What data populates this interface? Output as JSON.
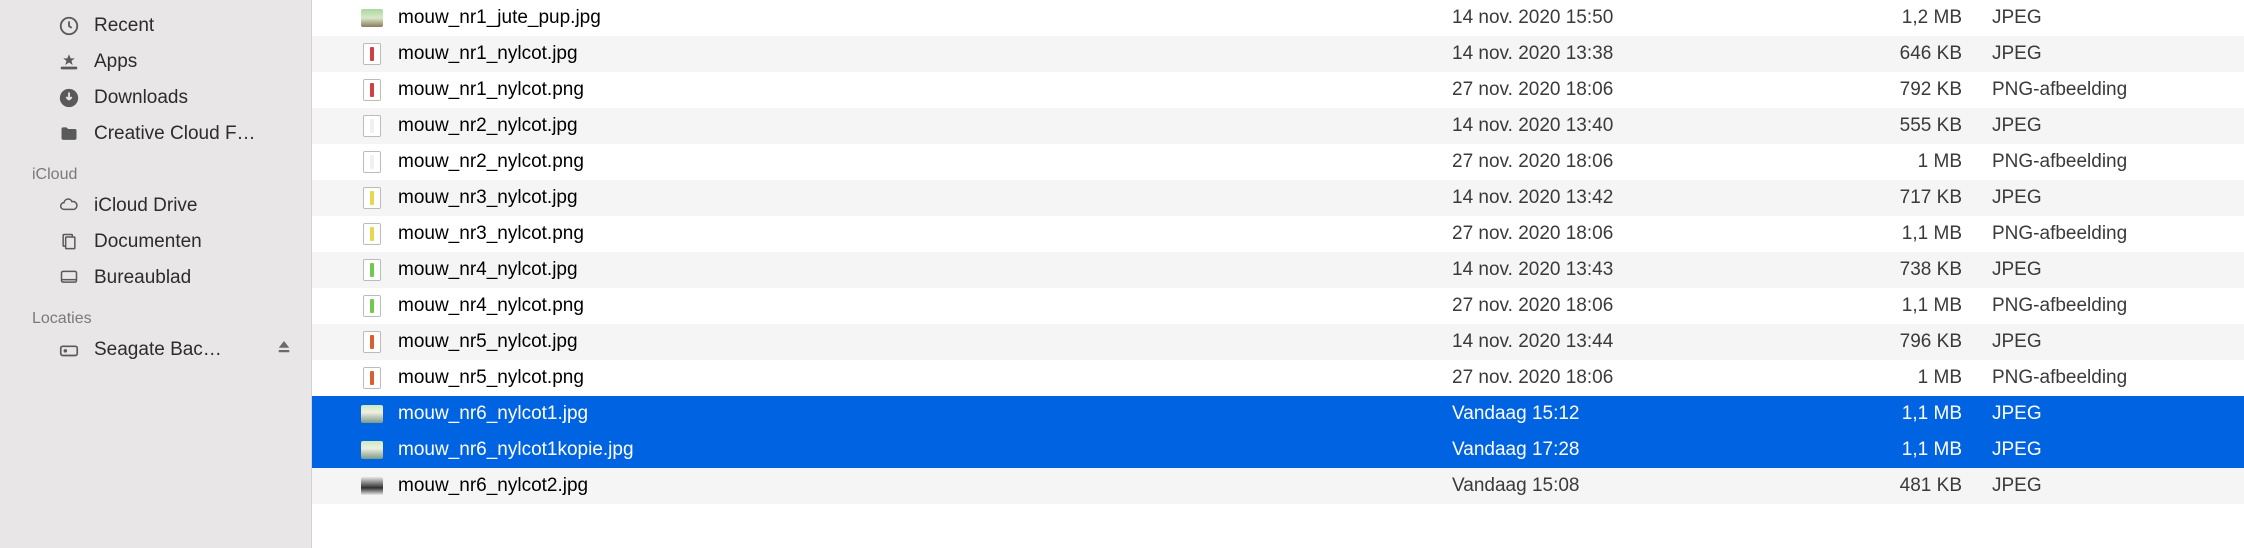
{
  "sidebar": {
    "favorites": [
      {
        "label": "Recent",
        "icon": "clock-icon"
      },
      {
        "label": "Apps",
        "icon": "apps-icon"
      },
      {
        "label": "Downloads",
        "icon": "downloads-icon"
      },
      {
        "label": "Creative Cloud F…",
        "icon": "folder-icon"
      }
    ],
    "icloud_header": "iCloud",
    "icloud": [
      {
        "label": "iCloud Drive",
        "icon": "cloud-icon"
      },
      {
        "label": "Documenten",
        "icon": "documents-icon"
      },
      {
        "label": "Bureaublad",
        "icon": "desktop-icon"
      }
    ],
    "locations_header": "Locaties",
    "locations": [
      {
        "label": "Seagate Bac…",
        "icon": "drive-icon",
        "eject": true
      }
    ]
  },
  "files": [
    {
      "name": "mouw_nr1_jute_pup.jpg",
      "date": "14 nov. 2020 15:50",
      "size": "1,2 MB",
      "kind": "JPEG",
      "iconType": "thumb",
      "selected": false
    },
    {
      "name": "mouw_nr1_nylcot.jpg",
      "date": "14 nov. 2020 13:38",
      "size": "646 KB",
      "kind": "JPEG",
      "iconType": "stripe",
      "stripeColor": "#d04040",
      "selected": false
    },
    {
      "name": "mouw_nr1_nylcot.png",
      "date": "27 nov. 2020 18:06",
      "size": "792 KB",
      "kind": "PNG-afbeelding",
      "iconType": "stripe",
      "stripeColor": "#d04040",
      "selected": false
    },
    {
      "name": "mouw_nr2_nylcot.jpg",
      "date": "14 nov. 2020 13:40",
      "size": "555 KB",
      "kind": "JPEG",
      "iconType": "stripe",
      "stripeColor": "#f0f0f0",
      "selected": false
    },
    {
      "name": "mouw_nr2_nylcot.png",
      "date": "27 nov. 2020 18:06",
      "size": "1 MB",
      "kind": "PNG-afbeelding",
      "iconType": "stripe",
      "stripeColor": "#f0f0f0",
      "selected": false
    },
    {
      "name": "mouw_nr3_nylcot.jpg",
      "date": "14 nov. 2020 13:42",
      "size": "717 KB",
      "kind": "JPEG",
      "iconType": "stripe",
      "stripeColor": "#e8d850",
      "selected": false
    },
    {
      "name": "mouw_nr3_nylcot.png",
      "date": "27 nov. 2020 18:06",
      "size": "1,1 MB",
      "kind": "PNG-afbeelding",
      "iconType": "stripe",
      "stripeColor": "#e8d850",
      "selected": false
    },
    {
      "name": "mouw_nr4_nylcot.jpg",
      "date": "14 nov. 2020 13:43",
      "size": "738 KB",
      "kind": "JPEG",
      "iconType": "stripe",
      "stripeColor": "#70c850",
      "selected": false
    },
    {
      "name": "mouw_nr4_nylcot.png",
      "date": "27 nov. 2020 18:06",
      "size": "1,1 MB",
      "kind": "PNG-afbeelding",
      "iconType": "stripe",
      "stripeColor": "#70c850",
      "selected": false
    },
    {
      "name": "mouw_nr5_nylcot.jpg",
      "date": "14 nov. 2020 13:44",
      "size": "796 KB",
      "kind": "JPEG",
      "iconType": "stripe",
      "stripeColor": "#d86030",
      "selected": false
    },
    {
      "name": "mouw_nr5_nylcot.png",
      "date": "27 nov. 2020 18:06",
      "size": "1 MB",
      "kind": "PNG-afbeelding",
      "iconType": "stripe",
      "stripeColor": "#d86030",
      "selected": false
    },
    {
      "name": "mouw_nr6_nylcot1.jpg",
      "date": "Vandaag 15:12",
      "size": "1,1 MB",
      "kind": "JPEG",
      "iconType": "thumb2",
      "selected": true
    },
    {
      "name": "mouw_nr6_nylcot1kopie.jpg",
      "date": "Vandaag 17:28",
      "size": "1,1 MB",
      "kind": "JPEG",
      "iconType": "thumb2",
      "selected": true
    },
    {
      "name": "mouw_nr6_nylcot2.jpg",
      "date": "Vandaag 15:08",
      "size": "481 KB",
      "kind": "JPEG",
      "iconType": "thumb3",
      "selected": false
    }
  ]
}
